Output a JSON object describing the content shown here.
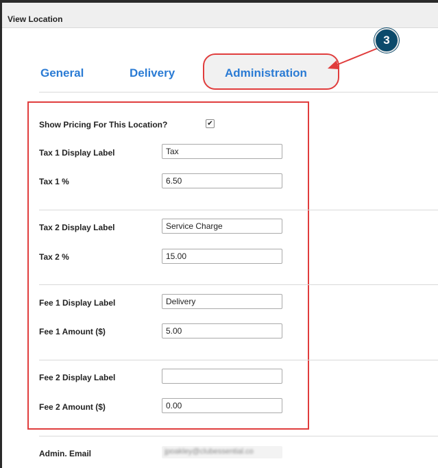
{
  "window": {
    "title": "View Location"
  },
  "callout": {
    "number": "3"
  },
  "tabs": [
    {
      "label": "General"
    },
    {
      "label": "Delivery"
    },
    {
      "label": "Administration"
    }
  ],
  "form": {
    "show_pricing": {
      "label": "Show Pricing For This Location?",
      "checked": true,
      "mark": "✔"
    },
    "tax1_label": {
      "label": "Tax 1 Display Label",
      "value": "Tax"
    },
    "tax1_pct": {
      "label": "Tax 1 %",
      "value": "6.50"
    },
    "tax2_label": {
      "label": "Tax 2 Display Label",
      "value": "Service Charge"
    },
    "tax2_pct": {
      "label": "Tax 2 %",
      "value": "15.00"
    },
    "fee1_label": {
      "label": "Fee 1 Display Label",
      "value": "Delivery"
    },
    "fee1_amount": {
      "label": "Fee 1 Amount ($)",
      "value": "5.00"
    },
    "fee2_label": {
      "label": "Fee 2 Display Label",
      "value": ""
    },
    "fee2_amount": {
      "label": "Fee 2 Amount ($)",
      "value": "0.00"
    },
    "admin_email": {
      "label": "Admin. Email",
      "value": "jpoakley@clubessential.co"
    }
  },
  "colors": {
    "accent_blue": "#2a7bd4",
    "annotation_red": "#e03c3c",
    "callout_fill": "#0b4a6b"
  }
}
